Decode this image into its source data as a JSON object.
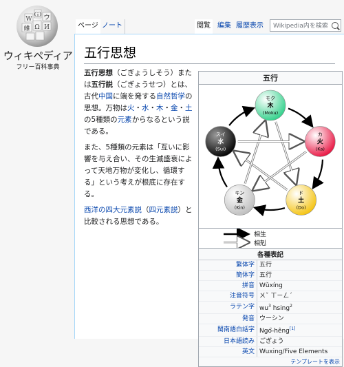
{
  "site": {
    "wordmark": "ウィキペディア",
    "tagline": "フリー百科事典",
    "globe_glyphs": [
      "W",
      "Ѡ",
      "ウ",
      "維",
      "Ω",
      "И"
    ]
  },
  "tabs": {
    "page": "ページ",
    "talk": "ノート",
    "read": "閲覧",
    "edit": "編集",
    "history": "履歴表示"
  },
  "search": {
    "placeholder": "Wikipedia内を検索"
  },
  "article": {
    "title": "五行思想",
    "para1": {
      "t1": "五行思想",
      "t2": "（ごぎょうしそう）または",
      "t3": "五行説",
      "t4": "（ごぎょうせつ）とは、古代",
      "l_china": "中国",
      "t5": "に端を発する",
      "l_nat": "自然哲学",
      "t6": "の思想。万物は",
      "l_fire": "火",
      "s1": "・",
      "l_water": "水",
      "s2": "・",
      "l_wood": "木",
      "s3": "・",
      "l_metal": "金",
      "s4": "・",
      "l_earth": "土",
      "t7": "の5種類の",
      "l_element": "元素",
      "t8": "からなるという説である。"
    },
    "para2": "また、5種類の元素は「互いに影響を与え合い、その生滅盛衰によって天地万物が変化し、循環する」という考えが根底に存在する。",
    "para3": {
      "l_four": "西洋の四大元素説",
      "t1": "（",
      "l_four2": "四元素説",
      "t2": "）と比較される思想である。"
    }
  },
  "infobox": {
    "title": "五行",
    "elements": [
      {
        "kana": "モク",
        "kanji": "木",
        "roman": "(Moku)",
        "color": "#2fd089"
      },
      {
        "kana": "カ",
        "kanji": "火",
        "roman": "(Ka)",
        "color": "#e8103e"
      },
      {
        "kana": "ド",
        "kanji": "土",
        "roman": "(Do)",
        "color": "#f4c20d"
      },
      {
        "kana": "キン",
        "kanji": "金",
        "roman": "(Kin)",
        "color": "#d8d8d8"
      },
      {
        "kana": "スイ",
        "kanji": "水",
        "roman": "(Sui)",
        "color": "#111111"
      }
    ],
    "legend": {
      "generate": "相生",
      "overcome": "相剋"
    },
    "subheader": "各種表記",
    "rows": [
      {
        "label": "繁体字",
        "value": "五行"
      },
      {
        "label": "簡体字",
        "value": "五行"
      },
      {
        "label": "拼音",
        "value": "Wǔxíng"
      },
      {
        "label": "注音符号",
        "value": "ㄨˇ ㄒㄧㄥˊ"
      },
      {
        "label": "ラテン字",
        "value": "wu",
        "sup1": "3",
        "value2": " hsing",
        "sup2": "2"
      },
      {
        "label": "発音",
        "value": "ウーシン"
      },
      {
        "label": "閩南語白話字",
        "value": "Ngó͘-hêng",
        "ref": "[1]"
      },
      {
        "label": "日本語読み",
        "value": "ごぎょう"
      },
      {
        "label": "英文",
        "value": "Wuxing/Five Elements"
      }
    ],
    "footer": "テンプレートを表示"
  }
}
